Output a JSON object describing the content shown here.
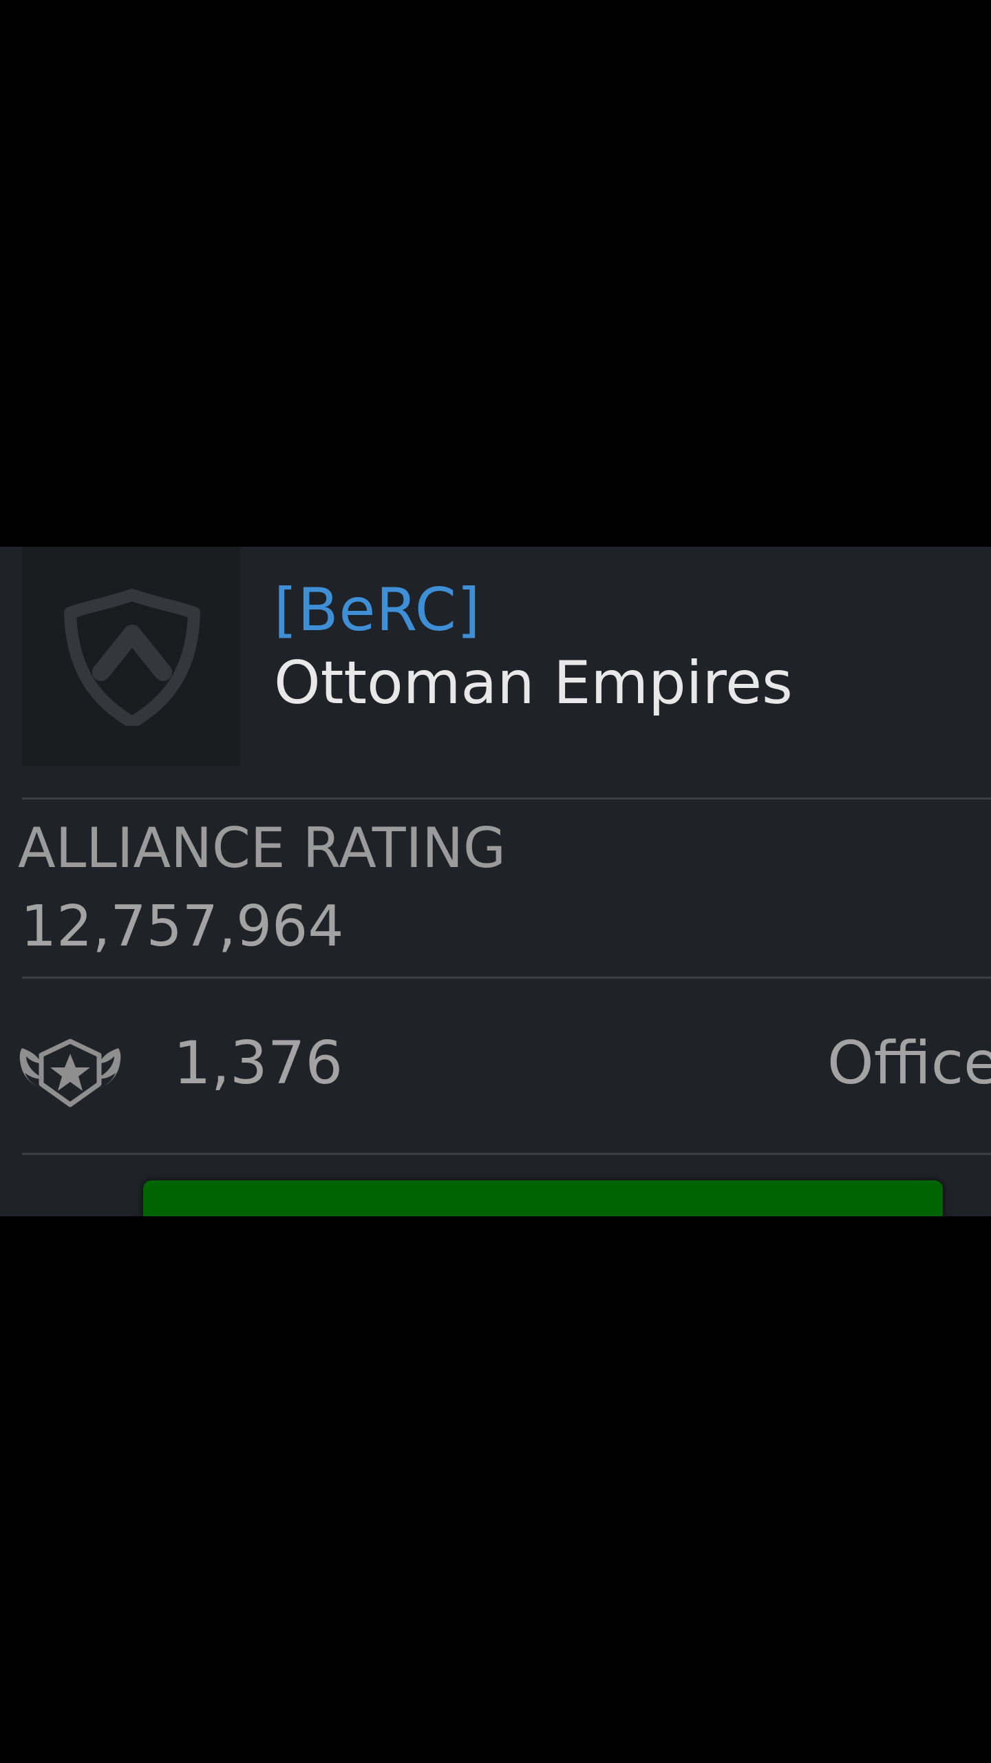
{
  "alliance": {
    "tag": "[BeRC]",
    "name": "Ottoman Empires",
    "emblem_icon": "shield-chevron-icon"
  },
  "rating": {
    "title": "ALLIANCE RATING",
    "value": "12,757,964"
  },
  "members": {
    "icon": "winged-star-badge-icon",
    "count": "1,376",
    "role_label": "Office"
  },
  "colors": {
    "tag": "#3f8fd6",
    "button": "#006400",
    "panel_bg": "#1f2227"
  }
}
